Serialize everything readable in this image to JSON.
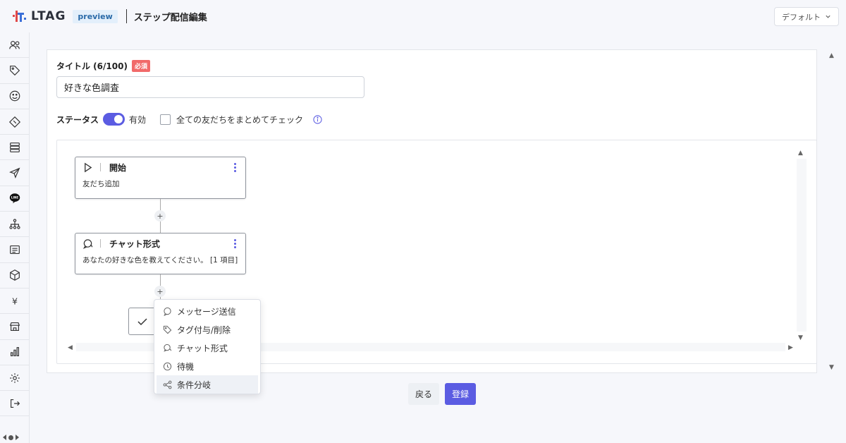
{
  "header": {
    "logo_text": "LTAG",
    "preview_badge": "preview",
    "page_title": "ステップ配信編集",
    "account_select": "デフォルト"
  },
  "sidebar": {
    "items": [
      {
        "icon": "users-icon"
      },
      {
        "icon": "tag-icon"
      },
      {
        "icon": "smile-icon"
      },
      {
        "icon": "ticket-icon"
      },
      {
        "icon": "database-icon"
      },
      {
        "icon": "send-icon"
      },
      {
        "icon": "line-icon",
        "text": "LINE"
      },
      {
        "icon": "sitemap-icon"
      },
      {
        "icon": "message-list-icon"
      },
      {
        "icon": "box-icon"
      },
      {
        "icon": "yen-icon",
        "text": "¥"
      },
      {
        "icon": "store-icon"
      },
      {
        "icon": "bar-chart-icon"
      },
      {
        "icon": "settings-icon"
      },
      {
        "icon": "logout-icon"
      }
    ]
  },
  "form": {
    "title_label": "タイトル (6/100)",
    "required_badge": "必須",
    "title_value": "好きな色調査",
    "status_label": "ステータス",
    "status_value": "有効",
    "check_all_label": "全ての友だちをまとめてチェック"
  },
  "flow": {
    "nodes": [
      {
        "title": "開始",
        "description": "友だち追加"
      },
      {
        "title": "チャット形式",
        "description": "あなたの好きな色を教えてください。 [1 項目]"
      }
    ],
    "add_symbol": "+"
  },
  "add_menu": {
    "items": [
      {
        "label": "メッセージ送信",
        "icon": "message-icon"
      },
      {
        "label": "タグ付与/削除",
        "icon": "tag-icon"
      },
      {
        "label": "チャット形式",
        "icon": "chat-icon"
      },
      {
        "label": "待機",
        "icon": "clock-icon"
      },
      {
        "label": "条件分岐",
        "icon": "branch-icon"
      }
    ],
    "highlighted": "条件分岐"
  },
  "actions": {
    "back_label": "戻る",
    "register_label": "登録"
  },
  "colors": {
    "accent": "#5b5ce2",
    "required": "#f16a6a",
    "preview_badge_bg": "#e3effb",
    "background": "#f6f7fb"
  }
}
